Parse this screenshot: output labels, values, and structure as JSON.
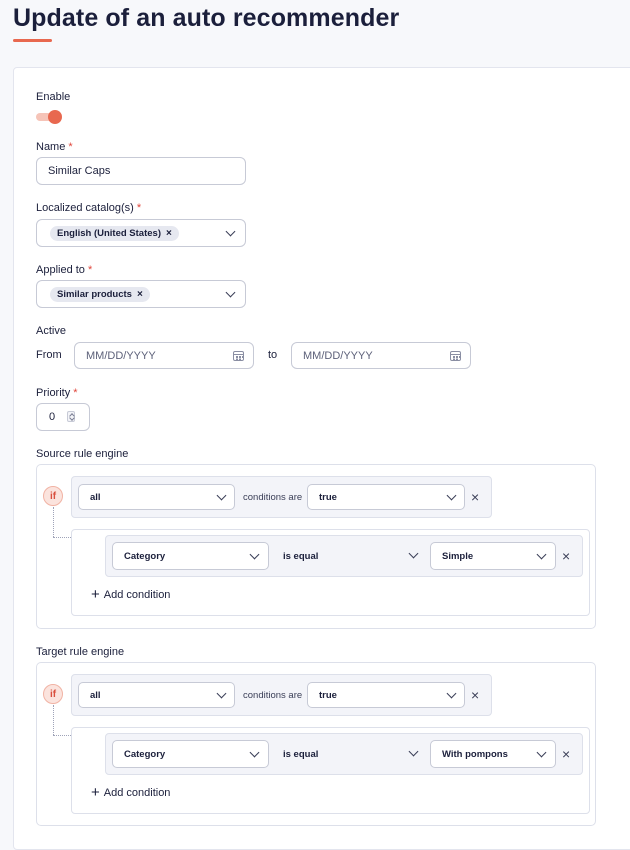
{
  "page_title": "Update of an auto recommender",
  "colors": {
    "accent": "#e8684f",
    "text": "#1b1f3b",
    "required": "#e0453a"
  },
  "enable": {
    "label": "Enable",
    "on": true
  },
  "name": {
    "label": "Name",
    "required_mark": "*",
    "value": "Similar Caps"
  },
  "catalogs": {
    "label": "Localized catalog(s)",
    "required_mark": "*",
    "chips": [
      "English (United States)"
    ],
    "remove_symbol": "×"
  },
  "applied_to": {
    "label": "Applied to",
    "required_mark": "*",
    "chips": [
      "Similar products"
    ],
    "remove_symbol": "×"
  },
  "active": {
    "label": "Active",
    "from_label": "From",
    "from_placeholder": "MM/DD/YYYY",
    "to_label": "to",
    "to_placeholder": "MM/DD/YYYY"
  },
  "priority": {
    "label": "Priority",
    "required_mark": "*",
    "value": "0"
  },
  "source_engine": {
    "label": "Source rule engine",
    "if_label": "if",
    "aggregator": "all",
    "conditions_are": "conditions are",
    "value": "true",
    "remove_symbol": "×",
    "condition": {
      "field": "Category",
      "operator": "is equal",
      "value": "Simple"
    },
    "add_condition": "Add condition"
  },
  "target_engine": {
    "label": "Target rule engine",
    "if_label": "if",
    "aggregator": "all",
    "conditions_are": "conditions are",
    "value": "true",
    "remove_symbol": "×",
    "condition": {
      "field": "Category",
      "operator": "is equal",
      "value": "With pompons"
    },
    "add_condition": "Add condition"
  },
  "icons": {
    "plus": "+",
    "chevron": "chevron-down-icon",
    "calendar": "calendar-icon"
  }
}
